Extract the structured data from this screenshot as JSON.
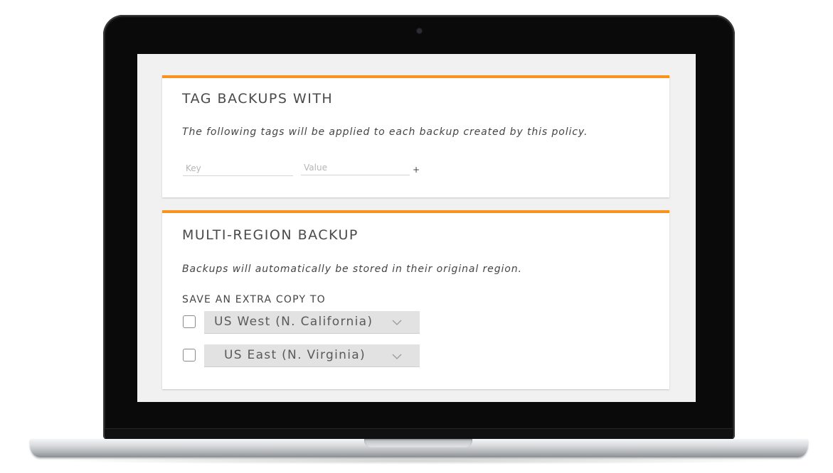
{
  "tag_section": {
    "title": "TAG BACKUPS WITH",
    "description": "The following tags will be applied to each backup created by this policy.",
    "key_placeholder": "Key",
    "value_placeholder": "Value",
    "add_label": "+"
  },
  "region_section": {
    "title": "MULTI-REGION BACKUP",
    "description": "Backups will automatically be stored in their original region.",
    "copy_label": "SAVE AN EXTRA COPY TO",
    "options": [
      {
        "label": "US West (N. California)",
        "checked": false,
        "icon": "chevron-down-icon"
      },
      {
        "label": "US East (N. Virginia)",
        "checked": false,
        "icon": "chevron-down-icon"
      }
    ]
  },
  "colors": {
    "accent": "#f7931e",
    "screen_background": "#f1f1f1",
    "card_background": "#ffffff",
    "select_background": "#e2e2e2",
    "bezel": "#0a0a0a"
  }
}
